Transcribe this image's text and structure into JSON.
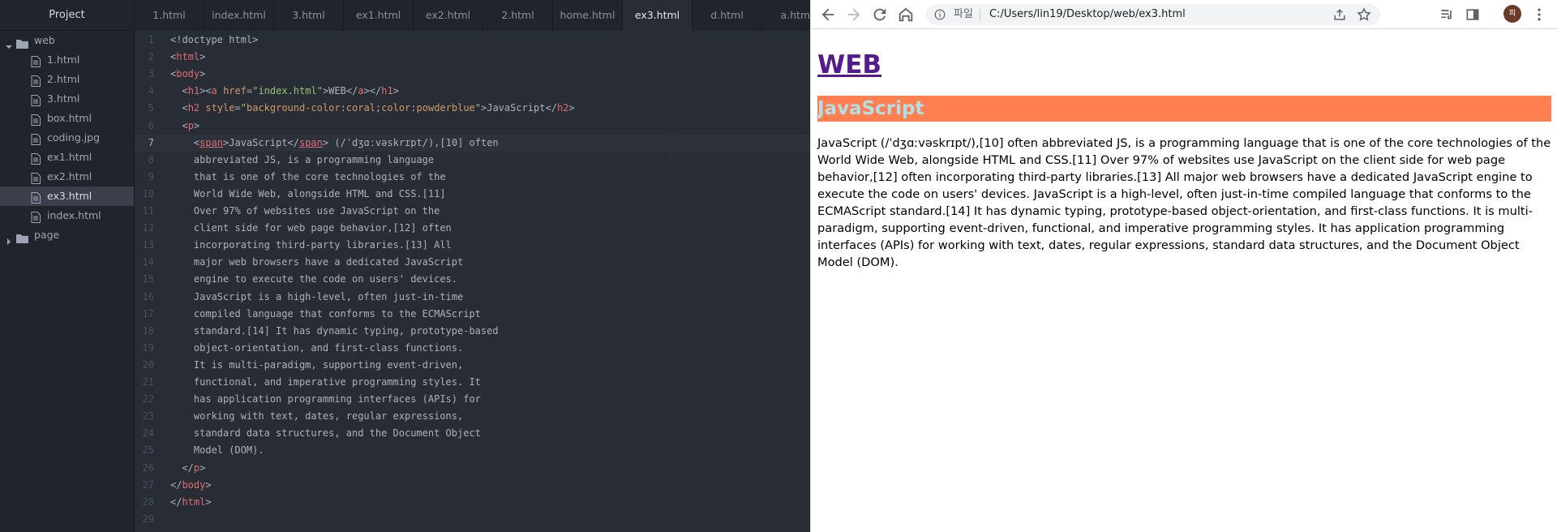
{
  "editor": {
    "sidebar_title": "Project",
    "tree": [
      {
        "label": "web",
        "type": "folder",
        "expanded": true
      },
      {
        "label": "1.html",
        "type": "file"
      },
      {
        "label": "2.html",
        "type": "file"
      },
      {
        "label": "3.html",
        "type": "file"
      },
      {
        "label": "box.html",
        "type": "file"
      },
      {
        "label": "coding.jpg",
        "type": "file"
      },
      {
        "label": "ex1.html",
        "type": "file"
      },
      {
        "label": "ex2.html",
        "type": "file"
      },
      {
        "label": "ex3.html",
        "type": "file",
        "selected": true
      },
      {
        "label": "index.html",
        "type": "file"
      },
      {
        "label": "page",
        "type": "folder",
        "expanded": false
      }
    ],
    "tabs": [
      "1.html",
      "index.html",
      "3.html",
      "ex1.html",
      "ex2.html",
      "2.html",
      "home.html",
      "ex3.html",
      "d.html",
      "a.html"
    ],
    "active_tab": "ex3.html",
    "current_line": 7,
    "code_lines": [
      "<!doctype html>",
      "<html>",
      "<body>",
      "  <h1><a href=\"index.html\">WEB</a></h1>",
      "  <h2 style=\"background-color:coral;color:powderblue\">JavaScript</h2>",
      "  <p>",
      "    <span>JavaScript</span> (/ˈdʒɑːvəskrɪpt/),[10] often",
      "    abbreviated JS, is a programming language",
      "    that is one of the core technologies of the",
      "    World Wide Web, alongside HTML and CSS.[11]",
      "    Over 97% of websites use JavaScript on the",
      "    client side for web page behavior,[12] often",
      "    incorporating third-party libraries.[13] All",
      "    major web browsers have a dedicated JavaScript",
      "    engine to execute the code on users' devices.",
      "    JavaScript is a high-level, often just-in-time",
      "    compiled language that conforms to the ECMAScript",
      "    standard.[14] It has dynamic typing, prototype-based",
      "    object-orientation, and first-class functions.",
      "    It is multi-paradigm, supporting event-driven,",
      "    functional, and imperative programming styles. It",
      "    has application programming interfaces (APIs) for",
      "    working with text, dates, regular expressions,",
      "    standard data structures, and the Document Object",
      "    Model (DOM).",
      "  </p>",
      "</body>",
      "</html>",
      ""
    ]
  },
  "browser": {
    "omnibox_label": "파일",
    "url": "C:/Users/lin19/Desktop/web/ex3.html",
    "avatar_letter": "피",
    "page": {
      "h1": "WEB",
      "h2": "JavaScript",
      "h2_background": "#ff7f50",
      "h2_color": "#b0e0e6",
      "link_color": "#551a8b",
      "paragraph": "JavaScript (/ˈdʒɑːvəskrɪpt/),[10] often abbreviated JS, is a programming language that is one of the core technologies of the World Wide Web, alongside HTML and CSS.[11] Over 97% of websites use JavaScript on the client side for web page behavior,[12] often incorporating third-party libraries.[13] All major web browsers have a dedicated JavaScript engine to execute the code on users' devices. JavaScript is a high-level, often just-in-time compiled language that conforms to the ECMAScript standard.[14] It has dynamic typing, prototype-based object-orientation, and first-class functions. It is multi-paradigm, supporting event-driven, functional, and imperative programming styles. It has application programming interfaces (APIs) for working with text, dates, regular expressions, standard data structures, and the Document Object Model (DOM)."
    }
  },
  "icons": {
    "back": "arrow-left-icon",
    "forward": "arrow-right-icon",
    "reload": "reload-icon",
    "home": "home-icon",
    "info": "info-icon",
    "share": "share-icon",
    "bookmark": "star-icon",
    "reading_list": "reading-list-icon",
    "side_panel": "side-panel-icon",
    "menu": "more-vert-icon"
  }
}
